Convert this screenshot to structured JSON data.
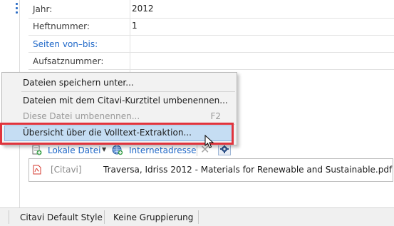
{
  "fields": {
    "jahr": {
      "label": "Jahr:",
      "value": "2012"
    },
    "heftnummer": {
      "label": "Heftnummer:",
      "value": "1"
    },
    "seiten": {
      "label": "Seiten von–bis:"
    },
    "aufsatznummer": {
      "label": "Aufsatznummer:"
    }
  },
  "context_menu": {
    "items": [
      {
        "label": "Dateien speichern unter...",
        "enabled": true
      },
      {
        "label": "Dateien mit dem Citavi-Kurztitel umbenennen...",
        "enabled": true
      },
      {
        "label": "Diese Datei umbenennen...",
        "shortcut": "F2",
        "enabled": false
      },
      {
        "label": "Übersicht über die Volltext-Extraktion...",
        "enabled": true,
        "highlighted": true
      }
    ]
  },
  "attachments_toolbar": {
    "local_file_label": "Lokale Datei",
    "internet_address_label": "Internetadresse"
  },
  "attachments": [
    {
      "tag": "[Citavi]",
      "name": "Traversa, Idriss 2012 - Materials for Renewable and Sustainable.pdf",
      "icon": "pdf-icon"
    }
  ],
  "status_bar": {
    "style": "Citavi Default Style",
    "grouping": "Keine Gruppierung"
  },
  "colors": {
    "link": "#1e67c8",
    "menu_highlight": "#c5ddf3",
    "annotation_frame": "#e0343d",
    "pdf_red": "#d63a2f"
  }
}
